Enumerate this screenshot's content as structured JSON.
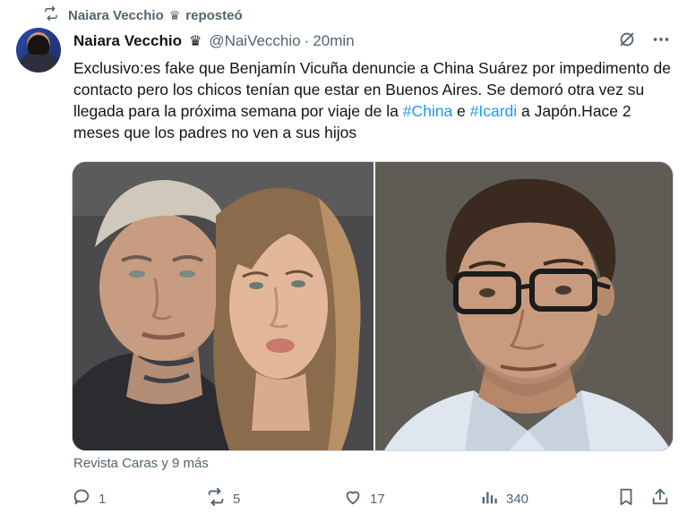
{
  "repost": {
    "icon": "repost-icon",
    "user": "Naiara Vecchio",
    "badge": "♛",
    "action": "reposteó"
  },
  "tweet": {
    "avatar_icon": "avatar",
    "author_name": "Naiara Vecchio",
    "badge": "♛",
    "handle": "@NaiVecchio",
    "separator": "·",
    "time": "20min",
    "text_part1": "Exclusivo:es fake que Benjamín Vicuña denuncie a China Suárez por impedimento de contacto pero los chicos tenían que estar en Buenos Aires. Se demoró otra vez su llegada para la próxima semana por viaje de la ",
    "hashtag1": "#China",
    "text_part2": " e ",
    "hashtag2": "#Icardi",
    "text_part3": " a Japón.Hace 2 meses que los padres no ven a sus hijos",
    "source": "Revista Caras y 9 más",
    "media": [
      {
        "description": "couple-selfie-photo"
      },
      {
        "description": "man-with-glasses-portrait"
      }
    ],
    "stats": {
      "replies": "1",
      "reposts": "5",
      "likes": "17",
      "views": "340"
    }
  },
  "colors": {
    "text": "#0f1419",
    "secondary": "#536471",
    "link": "#1d9bf0",
    "border": "#cfd9de"
  }
}
